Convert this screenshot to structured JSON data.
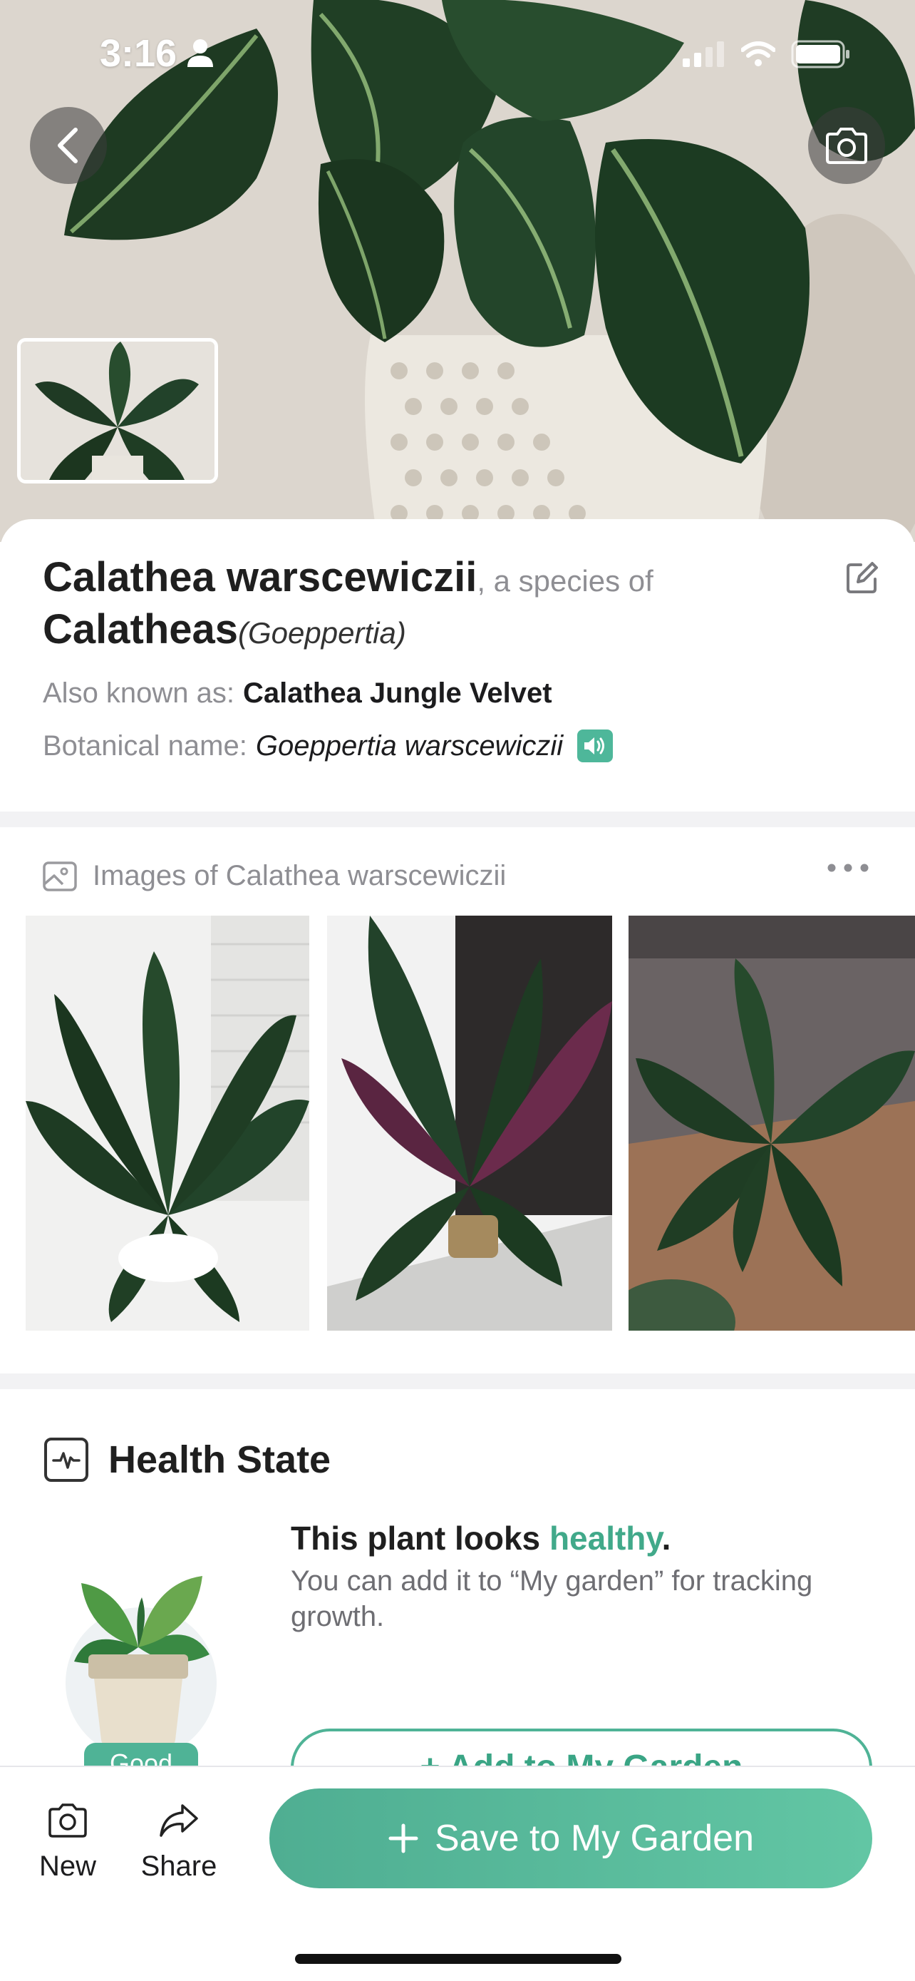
{
  "status_bar": {
    "time": "3:16"
  },
  "hero": {
    "back_icon": "chevron-left-icon",
    "camera_icon": "camera-icon"
  },
  "plant": {
    "common_name": "Calathea warscewiczii",
    "species_connector": ", a species of",
    "genus_common": "Calatheas",
    "genus_scientific": "(Goeppertia)",
    "also_known_label": "Also known as:",
    "also_known_value": "Calathea Jungle Velvet",
    "botanical_label": "Botanical name:",
    "botanical_value": "Goeppertia warscewiczii"
  },
  "images_section": {
    "title": "Images of Calathea warscewiczii"
  },
  "health": {
    "title": "Health State",
    "headline_prefix": "This plant looks ",
    "headline_status": "healthy",
    "headline_suffix": ".",
    "description": "You can add it to “My garden” for tracking growth.",
    "badge": "Good",
    "add_button": "+ Add to My Garden"
  },
  "bottom_bar": {
    "new_label": "New",
    "share_label": "Share",
    "save_label": "Save to My Garden"
  },
  "colors": {
    "accent": "#4fb396",
    "healthy_text": "#41a98a"
  }
}
